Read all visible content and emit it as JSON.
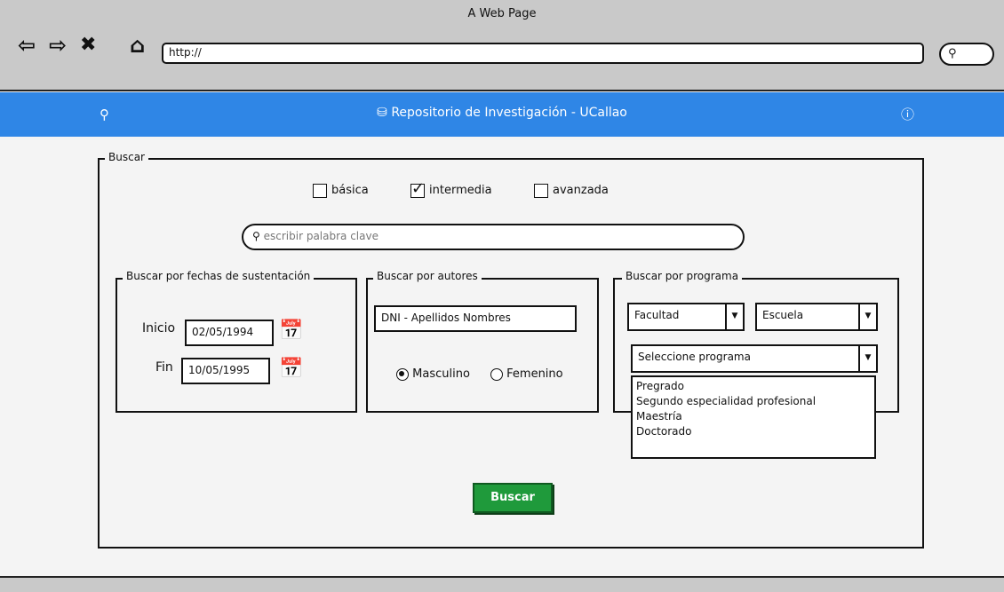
{
  "browser": {
    "window_title": "A Web Page",
    "url": "http://"
  },
  "header": {
    "title": "Repositorio de Investigación - UCallao",
    "accent_color": "#2f86e6"
  },
  "search": {
    "legend": "Buscar",
    "mode_options": [
      {
        "label": "básica",
        "checked": false
      },
      {
        "label": "intermedia",
        "checked": true
      },
      {
        "label": "avanzada",
        "checked": false
      }
    ],
    "keyword_placeholder": "escribir palabra clave",
    "dates": {
      "legend": "Buscar por fechas de sustentación",
      "start_label": "Inicio",
      "start_value": "02/05/1994",
      "end_label": "Fin",
      "end_value": "10/05/1995"
    },
    "authors": {
      "legend": "Buscar por autores",
      "input_value": "DNI - Apellidos Nombres",
      "gender_options": [
        {
          "label": "Masculino",
          "selected": true
        },
        {
          "label": "Femenino",
          "selected": false
        }
      ]
    },
    "program": {
      "legend": "Buscar por programa",
      "faculty_value": "Facultad",
      "school_value": "Escuela",
      "program_value": "Seleccione programa",
      "program_options": [
        "Pregrado",
        "Segundo especialidad profesional",
        "Maestría",
        "Doctorado"
      ]
    },
    "submit_label": "Buscar",
    "submit_color": "#1f9a3b"
  }
}
